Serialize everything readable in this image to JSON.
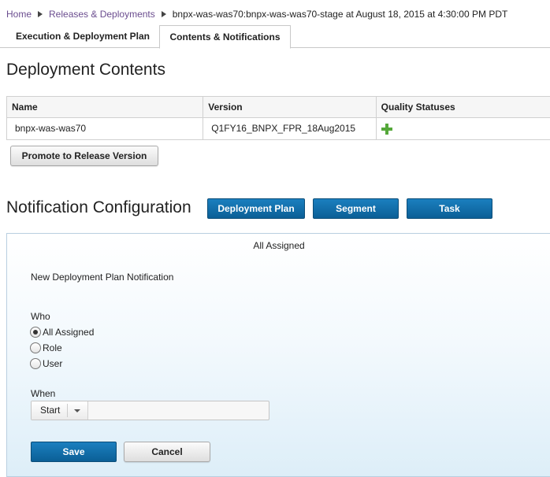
{
  "breadcrumb": {
    "home": "Home",
    "releases": "Releases & Deployments",
    "current": "bnpx-was-was70:bnpx-was-was70-stage at August 18, 2015 at 4:30:00 PM PDT"
  },
  "tabs": {
    "execution": "Execution & Deployment Plan",
    "contents": "Contents & Notifications"
  },
  "deployment_contents": {
    "title": "Deployment Contents",
    "columns": [
      "Name",
      "Version",
      "Quality Statuses"
    ],
    "rows": [
      {
        "name": "bnpx-was-was70",
        "version": "Q1FY16_BNPX_FPR_18Aug2015",
        "quality_icon": "plus-icon"
      }
    ],
    "promote_label": "Promote to Release Version"
  },
  "notification": {
    "title": "Notification Configuration",
    "buttons": {
      "deployment_plan": "Deployment Plan",
      "segment": "Segment",
      "task": "Task"
    },
    "panel": {
      "header": "All Assigned",
      "new_label": "New Deployment Plan Notification",
      "who_label": "Who",
      "who_options": [
        "All Assigned",
        "Role",
        "User"
      ],
      "who_selected": "All Assigned",
      "when_label": "When",
      "when_value": "Start",
      "save_label": "Save",
      "cancel_label": "Cancel"
    }
  },
  "colors": {
    "link": "#6b4d8f",
    "primary_button": "#0b5f96",
    "plus_icon": "#55a83a"
  }
}
